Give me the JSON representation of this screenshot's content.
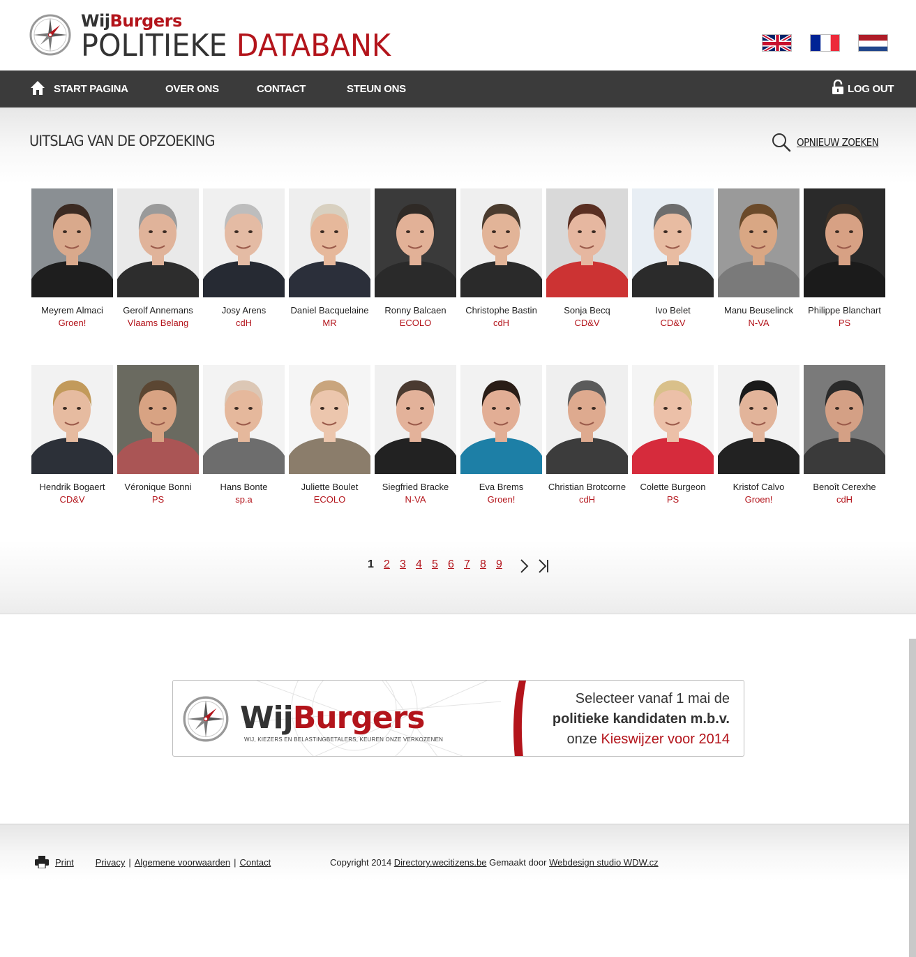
{
  "header": {
    "brand_wij": "Wij",
    "brand_burgers": "Burgers",
    "title_part1": "POLITIEKE ",
    "title_part2": "DATABANK",
    "languages": [
      {
        "name": "english-flag-icon",
        "code": "EN"
      },
      {
        "name": "french-flag-icon",
        "code": "FR"
      },
      {
        "name": "dutch-flag-icon",
        "code": "NL"
      }
    ]
  },
  "nav": {
    "home": "START PAGINA",
    "about": "OVER ONS",
    "contact": "CONTACT",
    "support": "STEUN ONS",
    "logout": "LOG OUT"
  },
  "main": {
    "title": "UITSLAG VAN DE OPZOEKING",
    "new_search": "OPNIEUW ZOEKEN"
  },
  "results": [
    {
      "name": "Meyrem Almaci",
      "party": "Groen!"
    },
    {
      "name": "Gerolf Annemans",
      "party": "Vlaams Belang"
    },
    {
      "name": "Josy Arens",
      "party": "cdH"
    },
    {
      "name": "Daniel Bacquelaine",
      "party": "MR"
    },
    {
      "name": "Ronny Balcaen",
      "party": "ECOLO"
    },
    {
      "name": "Christophe Bastin",
      "party": "cdH"
    },
    {
      "name": "Sonja Becq",
      "party": "CD&V"
    },
    {
      "name": "Ivo Belet",
      "party": "CD&V"
    },
    {
      "name": "Manu Beuselinck",
      "party": "N-VA"
    },
    {
      "name": "Philippe Blanchart",
      "party": "PS"
    },
    {
      "name": "Hendrik Bogaert",
      "party": "CD&V"
    },
    {
      "name": "Véronique Bonni",
      "party": "PS"
    },
    {
      "name": "Hans Bonte",
      "party": "sp.a"
    },
    {
      "name": "Juliette Boulet",
      "party": "ECOLO"
    },
    {
      "name": "Siegfried Bracke",
      "party": "N-VA"
    },
    {
      "name": "Eva Brems",
      "party": "Groen!"
    },
    {
      "name": "Christian Brotcorne",
      "party": "cdH"
    },
    {
      "name": "Colette Burgeon",
      "party": "PS"
    },
    {
      "name": "Kristof Calvo",
      "party": "Groen!"
    },
    {
      "name": "Benoît Cerexhe",
      "party": "cdH"
    }
  ],
  "pagination": {
    "current": "1",
    "pages": [
      "2",
      "3",
      "4",
      "5",
      "6",
      "7",
      "8",
      "9"
    ]
  },
  "banner": {
    "brand_wij": "Wij",
    "brand_burgers": "Burgers",
    "tagline": "WIJ, KIEZERS EN BELASTINGBETALERS, KEUREN ONZE VERKOZENEN",
    "line1": "Selecteer vanaf 1 mai de",
    "line2": "politieke kandidaten m.b.v.",
    "line3_prefix": "onze ",
    "line3_link": "Kieswijzer voor 2014"
  },
  "footer": {
    "print": "Print",
    "privacy": "Privacy",
    "terms": "Algemene voorwaarden",
    "contact": "Contact",
    "copyright_prefix": "Copyright 2014 ",
    "site_link": "Directory.wecitizens.be",
    "made_by": " Gemaakt door ",
    "studio_link": "Webdesign studio WDW.cz"
  },
  "colors": {
    "accent": "#b3141b",
    "nav_bg": "#3b3b3b"
  }
}
